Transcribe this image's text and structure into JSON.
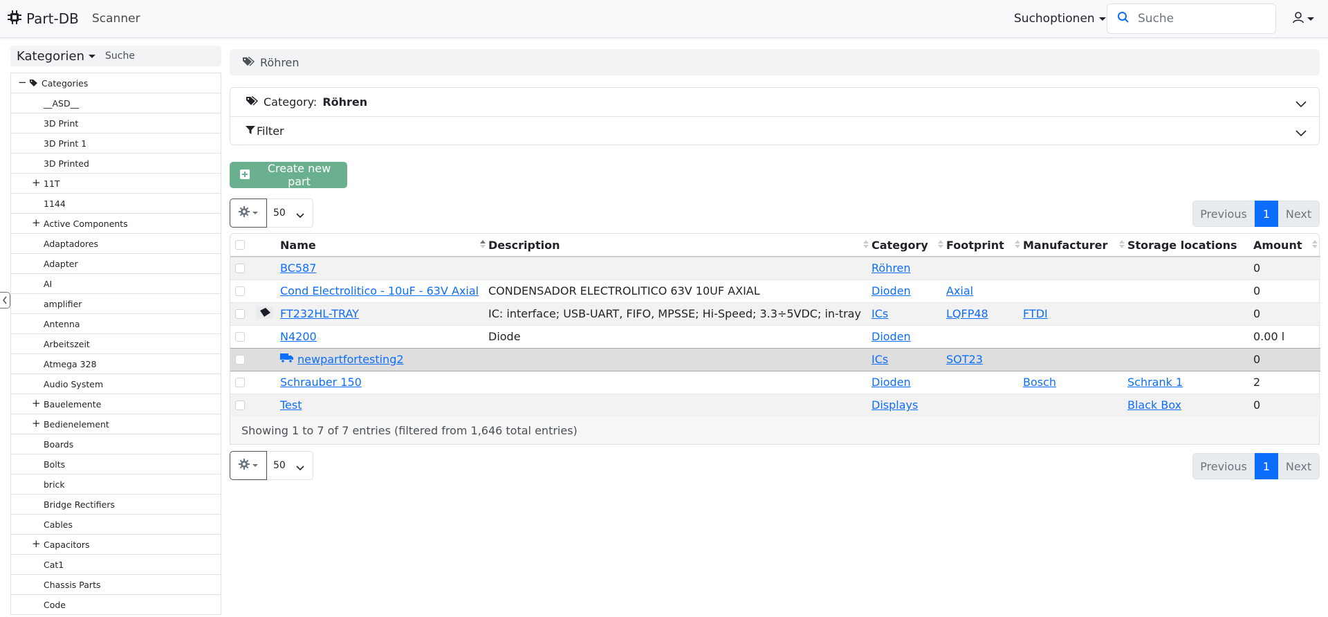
{
  "navbar": {
    "brand": "Part-DB",
    "scanner": "Scanner",
    "search_options": "Suchoptionen",
    "search_placeholder": "Suche"
  },
  "sidebar": {
    "title": "Kategorien",
    "search_placeholder": "Suche",
    "root": "Categories",
    "items": [
      {
        "label": "__ASD__",
        "expandable": false
      },
      {
        "label": "3D Print",
        "expandable": false
      },
      {
        "label": "3D Print 1",
        "expandable": false
      },
      {
        "label": "3D Printed",
        "expandable": false
      },
      {
        "label": "11T",
        "expandable": true
      },
      {
        "label": "1144",
        "expandable": false
      },
      {
        "label": "Active Components",
        "expandable": true
      },
      {
        "label": "Adaptadores",
        "expandable": false
      },
      {
        "label": "Adapter",
        "expandable": false
      },
      {
        "label": "AI",
        "expandable": false
      },
      {
        "label": "amplifier",
        "expandable": false
      },
      {
        "label": "Antenna",
        "expandable": false
      },
      {
        "label": "Arbeitszeit",
        "expandable": false
      },
      {
        "label": "Atmega 328",
        "expandable": false
      },
      {
        "label": "Audio System",
        "expandable": false
      },
      {
        "label": "Bauelemente",
        "expandable": true
      },
      {
        "label": "Bedienelement",
        "expandable": true
      },
      {
        "label": "Boards",
        "expandable": false
      },
      {
        "label": "Bolts",
        "expandable": false
      },
      {
        "label": "brick",
        "expandable": false
      },
      {
        "label": "Bridge Rectifiers",
        "expandable": false
      },
      {
        "label": "Cables",
        "expandable": false
      },
      {
        "label": "Capacitors",
        "expandable": true
      },
      {
        "label": "Cat1",
        "expandable": false
      },
      {
        "label": "Chassis Parts",
        "expandable": false
      },
      {
        "label": "Code",
        "expandable": false
      }
    ]
  },
  "breadcrumb": "Röhren",
  "accordion": {
    "category_prefix": "Category:",
    "category_name": "Röhren",
    "filter": "Filter"
  },
  "create_button": "Create new part",
  "page_length": "50",
  "pagination": {
    "previous": "Previous",
    "current": "1",
    "next": "Next"
  },
  "table": {
    "columns": [
      "Name",
      "Description",
      "Category",
      "Footprint",
      "Manufacturer",
      "Storage locations",
      "Amount"
    ],
    "rows": [
      {
        "name": "BC587",
        "description": "",
        "category": "Röhren",
        "footprint": "",
        "manufacturer": "",
        "storage": "",
        "amount": "0",
        "thumbnail": false,
        "icon": ""
      },
      {
        "name": "Cond Electrolitico - 10uF - 63V Axial",
        "description": "CONDENSADOR ELECTROLITICO 63V 10UF AXIAL",
        "category": "Dioden",
        "footprint": "Axial",
        "manufacturer": "",
        "storage": "",
        "amount": "0",
        "thumbnail": false,
        "icon": ""
      },
      {
        "name": "FT232HL-TRAY",
        "description": "IC: interface; USB-UART, FIFO, MPSSE; Hi-Speed; 3.3÷5VDC; in-tray",
        "category": "ICs",
        "footprint": "LQFP48",
        "manufacturer": "FTDI",
        "storage": "",
        "amount": "0",
        "thumbnail": true,
        "icon": ""
      },
      {
        "name": "N4200",
        "description": "Diode",
        "category": "Dioden",
        "footprint": "",
        "manufacturer": "",
        "storage": "",
        "amount": "0.00 l",
        "thumbnail": false,
        "icon": ""
      },
      {
        "name": "newpartfortesting2",
        "description": "",
        "category": "ICs",
        "footprint": "SOT23",
        "manufacturer": "",
        "storage": "",
        "amount": "0",
        "thumbnail": false,
        "icon": "truck-icon"
      },
      {
        "name": "Schrauber 150",
        "description": "",
        "category": "Dioden",
        "footprint": "",
        "manufacturer": "Bosch",
        "storage": "Schrank 1",
        "amount": "2",
        "thumbnail": false,
        "icon": ""
      },
      {
        "name": "Test",
        "description": "",
        "category": "Displays",
        "footprint": "",
        "manufacturer": "",
        "storage": "Black Box",
        "amount": "0",
        "thumbnail": false,
        "icon": ""
      }
    ],
    "info": "Showing 1 to 7 of 7 entries (filtered from 1,646 total entries)"
  },
  "colors": {
    "primary": "#0d6efd",
    "success": "#6bb08e",
    "highlight_row": "#dedede"
  }
}
